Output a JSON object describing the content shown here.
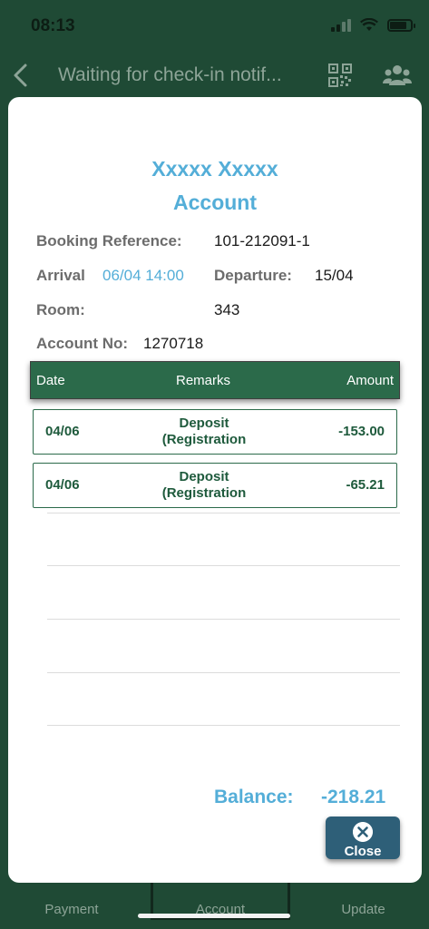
{
  "status_bar": {
    "time": "08:13"
  },
  "nav": {
    "title": "Waiting for check-in notif..."
  },
  "modal": {
    "guest_name": "Xxxxx Xxxxx",
    "heading": "Account",
    "booking_reference_label": "Booking Reference:",
    "booking_reference_value": "101-212091-1",
    "arrival_label": "Arrival",
    "arrival_value": "06/04 14:00",
    "departure_label": "Departure:",
    "departure_value": "15/04",
    "room_label": "Room:",
    "room_value": "343",
    "account_no_label": "Account No:",
    "account_no_value": "1270718",
    "table": {
      "headers": {
        "date": "Date",
        "remarks": "Remarks",
        "amount": "Amount"
      },
      "rows": [
        {
          "date": "04/06",
          "remarks_line1": "Deposit",
          "remarks_line2": "(Registration",
          "amount": "-153.00"
        },
        {
          "date": "04/06",
          "remarks_line1": "Deposit",
          "remarks_line2": "(Registration",
          "amount": "-65.21"
        }
      ]
    },
    "balance_label": "Balance:",
    "balance_value": "-218.21",
    "close_label": "Close"
  },
  "tabs": [
    {
      "label": "Payment"
    },
    {
      "label": "Account"
    },
    {
      "label": "Update"
    }
  ],
  "colors": {
    "header_green": "#1f4a35",
    "table_green": "#2b6a4a",
    "accent_blue": "#54aed8",
    "close_button": "#2e5f78"
  }
}
